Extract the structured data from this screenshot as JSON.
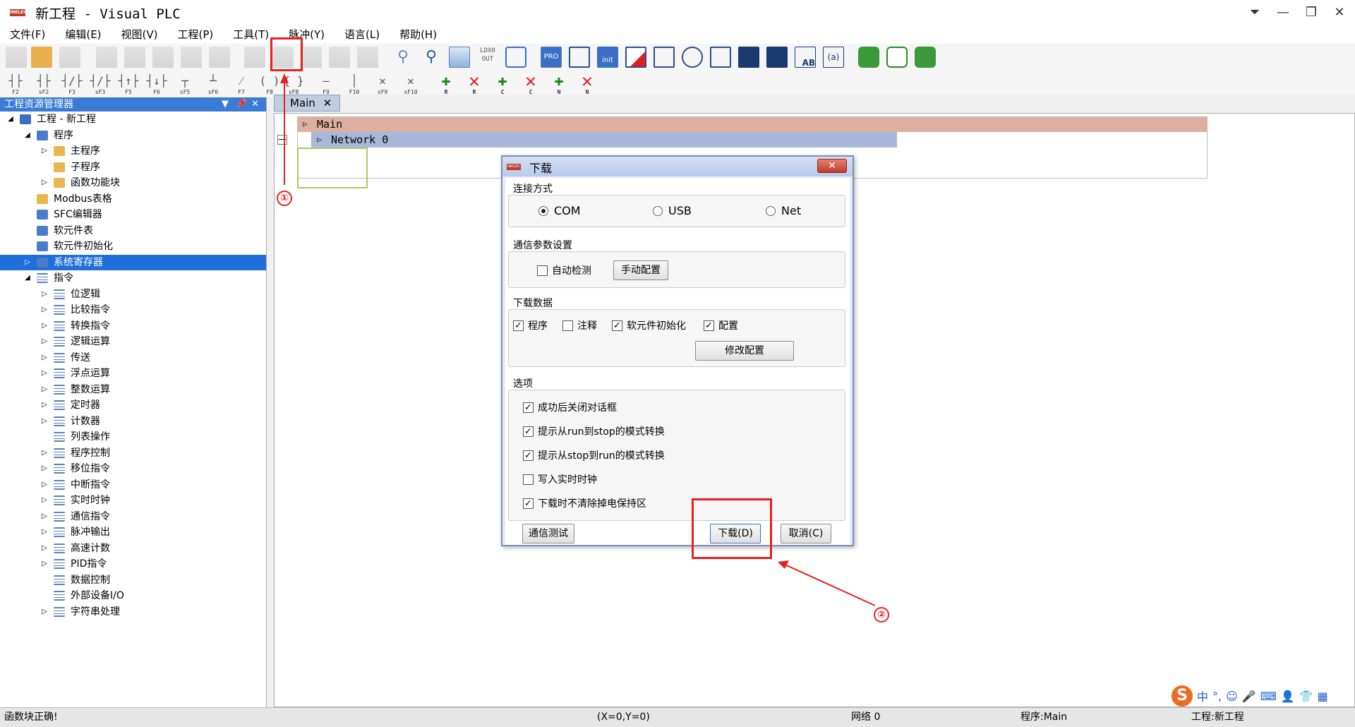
{
  "app": {
    "title": "新工程 - Visual PLC",
    "logo_text": "INELEC"
  },
  "window_controls": {
    "filter": "⏷",
    "minimize": "—",
    "restore": "❐",
    "close": "✕"
  },
  "menu": [
    "文件(F)",
    "编辑(E)",
    "视图(V)",
    "工程(P)",
    "工具(T)",
    "脉冲(Y)",
    "语言(L)",
    "帮助(H)"
  ],
  "toolbar1": {
    "ldx_label": "LDX0\nOUT",
    "pro_label": "PRO",
    "init_label": "init",
    "ab_label": "AB",
    "a_label": "(a)"
  },
  "toolbar2": {
    "ladder_keys": [
      "F2",
      "sF2",
      "F3",
      "sF3",
      "F5",
      "F6",
      "sF5",
      "sF6",
      "F7",
      "F8",
      "sF8",
      "F9",
      "F10",
      "sF9",
      "sF10"
    ],
    "edit_keys": [
      "R",
      "R",
      "C",
      "C",
      "N",
      "N"
    ]
  },
  "project_panel": {
    "title": "工程资源管理器",
    "btn_dropdown": "▼",
    "btn_pin": "📌",
    "btn_close": "✕",
    "tree": [
      {
        "label": "工程 - 新工程",
        "level": 0,
        "arrow": "◢",
        "icon": "proj"
      },
      {
        "label": "程序",
        "level": 1,
        "arrow": "◢",
        "icon": "blue"
      },
      {
        "label": "主程序",
        "level": 2,
        "arrow": "▷",
        "icon": "folder"
      },
      {
        "label": "子程序",
        "level": 2,
        "arrow": "",
        "icon": "folder"
      },
      {
        "label": "函数功能块",
        "level": 2,
        "arrow": "▷",
        "icon": "folder"
      },
      {
        "label": "Modbus表格",
        "level": 1,
        "arrow": "",
        "icon": "folder"
      },
      {
        "label": "SFC编辑器",
        "level": 1,
        "arrow": "",
        "icon": "blue"
      },
      {
        "label": "软元件表",
        "level": 1,
        "arrow": "",
        "icon": "blue"
      },
      {
        "label": "软元件初始化",
        "level": 1,
        "arrow": "",
        "icon": "blue"
      },
      {
        "label": "系统寄存器",
        "level": 1,
        "arrow": "▷",
        "icon": "blue",
        "selected": true
      },
      {
        "label": "指令",
        "level": 1,
        "arrow": "◢",
        "icon": "list"
      },
      {
        "label": "位逻辑",
        "level": 2,
        "arrow": "▷",
        "icon": "list"
      },
      {
        "label": "比较指令",
        "level": 2,
        "arrow": "▷",
        "icon": "list"
      },
      {
        "label": "转换指令",
        "level": 2,
        "arrow": "▷",
        "icon": "list"
      },
      {
        "label": "逻辑运算",
        "level": 2,
        "arrow": "▷",
        "icon": "list"
      },
      {
        "label": "传送",
        "level": 2,
        "arrow": "▷",
        "icon": "list"
      },
      {
        "label": "浮点运算",
        "level": 2,
        "arrow": "▷",
        "icon": "list"
      },
      {
        "label": "整数运算",
        "level": 2,
        "arrow": "▷",
        "icon": "list"
      },
      {
        "label": "定时器",
        "level": 2,
        "arrow": "▷",
        "icon": "list"
      },
      {
        "label": "计数器",
        "level": 2,
        "arrow": "▷",
        "icon": "list"
      },
      {
        "label": "列表操作",
        "level": 2,
        "arrow": "",
        "icon": "list"
      },
      {
        "label": "程序控制",
        "level": 2,
        "arrow": "▷",
        "icon": "list"
      },
      {
        "label": "移位指令",
        "level": 2,
        "arrow": "▷",
        "icon": "list"
      },
      {
        "label": "中断指令",
        "level": 2,
        "arrow": "▷",
        "icon": "list"
      },
      {
        "label": "实时时钟",
        "level": 2,
        "arrow": "▷",
        "icon": "list"
      },
      {
        "label": "通信指令",
        "level": 2,
        "arrow": "▷",
        "icon": "list"
      },
      {
        "label": "脉冲输出",
        "level": 2,
        "arrow": "▷",
        "icon": "list"
      },
      {
        "label": "高速计数",
        "level": 2,
        "arrow": "▷",
        "icon": "list"
      },
      {
        "label": "PID指令",
        "level": 2,
        "arrow": "▷",
        "icon": "list"
      },
      {
        "label": "数据控制",
        "level": 2,
        "arrow": "",
        "icon": "list"
      },
      {
        "label": "外部设备I/O",
        "level": 2,
        "arrow": "",
        "icon": "list"
      },
      {
        "label": "字符串处理",
        "level": 2,
        "arrow": "▷",
        "icon": "list"
      }
    ]
  },
  "editor": {
    "tab_label": "Main",
    "tab_close": "✕",
    "block_title": "Main",
    "network_title": "Network 0",
    "collapse_symbol": "—"
  },
  "dialog": {
    "title": "下载",
    "close_symbol": "✕",
    "conn_group": "连接方式",
    "conn_options": [
      "COM",
      "USB",
      "Net"
    ],
    "conn_selected": "COM",
    "comm_group": "通信参数设置",
    "auto_detect": "自动检测",
    "manual_config": "手动配置",
    "data_group": "下载数据",
    "data_items": [
      {
        "label": "程序",
        "checked": true
      },
      {
        "label": "注释",
        "checked": false
      },
      {
        "label": "软元件初始化",
        "checked": true
      },
      {
        "label": "配置",
        "checked": true
      }
    ],
    "modify_config": "修改配置",
    "options_group": "选项",
    "options": [
      {
        "label": "成功后关闭对话框",
        "checked": true
      },
      {
        "label": "提示从run到stop的模式转换",
        "checked": true
      },
      {
        "label": "提示从stop到run的模式转换",
        "checked": true
      },
      {
        "label": "写入实时时钟",
        "checked": false
      },
      {
        "label": "下载时不清除掉电保持区",
        "checked": true
      }
    ],
    "comm_test": "通信测试",
    "download_btn": "下载(D)",
    "cancel_btn": "取消(C)"
  },
  "annotations": {
    "num1": "①",
    "num2": "②"
  },
  "status": {
    "message": "函数块正确!",
    "coords": "(X=0,Y=0)",
    "network": "网络 0",
    "program": "程序:Main",
    "project": "工程:新工程"
  },
  "ime": {
    "logo": "S",
    "lang": "中",
    "punct": "°,",
    "emoji": "☺",
    "mic": "🎤",
    "kbd": "⌨",
    "user": "👤",
    "shirt": "👕",
    "grid": "▦"
  }
}
